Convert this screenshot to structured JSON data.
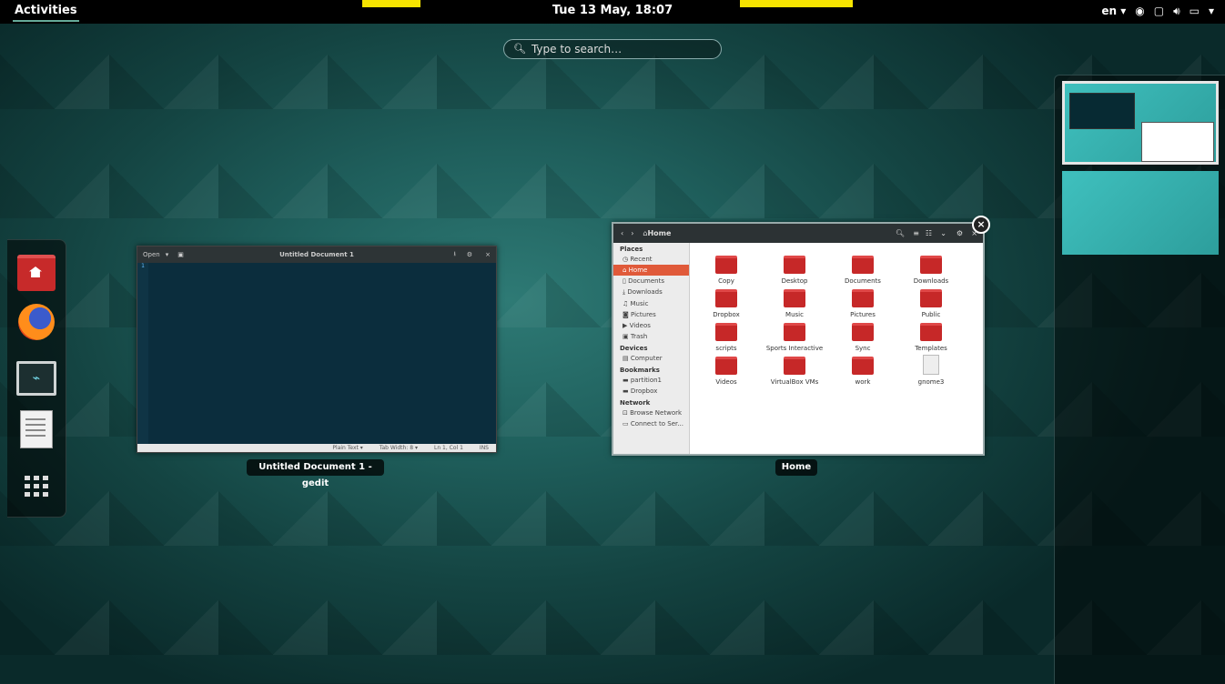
{
  "topbar": {
    "activities": "Activities",
    "clock": "Tue 13 May, 18:07",
    "lang": "en ▾",
    "icons": [
      "accessibility-icon",
      "display-icon",
      "volume-icon",
      "battery-icon",
      "chevron-down-icon"
    ]
  },
  "search": {
    "placeholder": "Type to search…"
  },
  "dash": {
    "items": [
      "files",
      "firefox",
      "system-monitor",
      "text-editor",
      "show-applications"
    ]
  },
  "gedit": {
    "open": "Open",
    "title": "Untitled Document 1",
    "line": "1",
    "status": {
      "lang": "Plain Text ▾",
      "tab": "Tab Width: 8 ▾",
      "pos": "Ln 1, Col 1",
      "ins": "INS"
    },
    "caption": "Untitled Document 1 - gedit"
  },
  "nautilus": {
    "path": "Home",
    "caption": "Home",
    "sidebar": {
      "places_header": "Places",
      "places": [
        "Recent",
        "Home",
        "Documents",
        "Downloads",
        "Music",
        "Pictures",
        "Videos",
        "Trash"
      ],
      "devices_header": "Devices",
      "devices": [
        "Computer"
      ],
      "bookmarks_header": "Bookmarks",
      "bookmarks": [
        "partition1",
        "Dropbox"
      ],
      "network_header": "Network",
      "network": [
        "Browse Network",
        "Connect to Ser..."
      ]
    },
    "files": [
      "Copy",
      "Desktop",
      "Documents",
      "Downloads",
      "Dropbox",
      "Music",
      "Pictures",
      "Public",
      "scripts",
      "Sports Interactive",
      "Sync",
      "Templates",
      "Videos",
      "VirtualBox VMs",
      "work",
      "gnome3"
    ]
  },
  "colors": {
    "accent": "#e05a3a",
    "folder": "#c62828",
    "topbar": "#000000",
    "highlight": "#f6e400"
  }
}
